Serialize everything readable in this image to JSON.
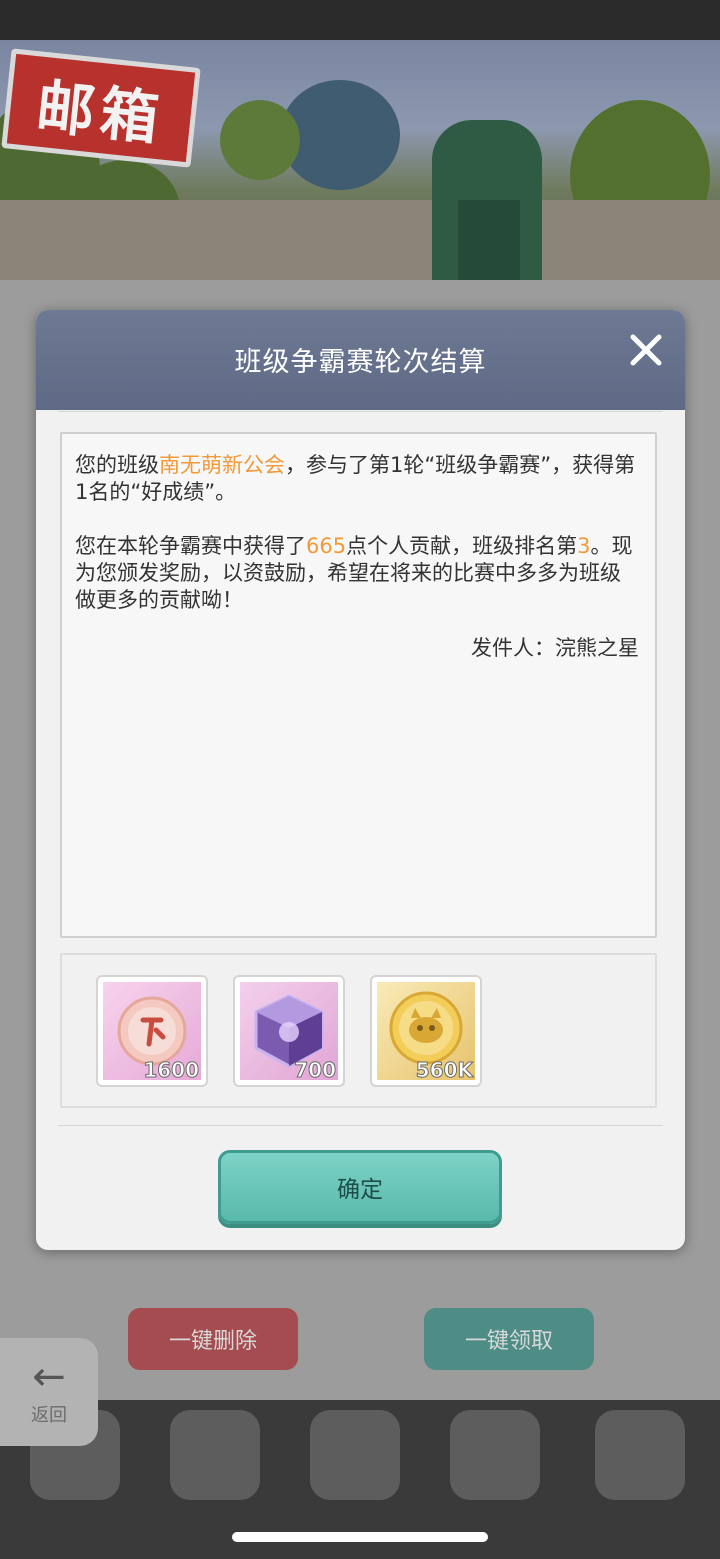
{
  "scene": {
    "sign_text": "邮箱"
  },
  "dialog": {
    "title": "班级争霸赛轮次结算",
    "message": {
      "p1_a": "您的班级",
      "p1_guild": "南无萌新公会",
      "p1_b": "，参与了第1轮“班级争霸赛”，获得第1名的“好成绩”。",
      "p2_a": "您在本轮争霸赛中获得了",
      "p2_points": "665",
      "p2_b": "点个人贡献，班级排名第",
      "p2_rank": "3",
      "p2_c": "。现为您颁发奖励，以资鼓励，希望在将来的比赛中多多为班级做更多的贡献呦！",
      "sender": "发件人：浣熊之星"
    },
    "rewards": [
      {
        "icon": "contribution-orb-icon",
        "qty": "1600"
      },
      {
        "icon": "purple-cube-icon",
        "qty": "700"
      },
      {
        "icon": "raccoon-gold-coin-icon",
        "qty": "560K"
      }
    ],
    "confirm_label": "确定"
  },
  "background_buttons": {
    "delete_all": "一键删除",
    "claim_all": "一键领取",
    "back": "返回"
  },
  "colors": {
    "highlight": "#f09a3a",
    "header": "#6e7a94",
    "confirm": "#6cc7b9"
  }
}
